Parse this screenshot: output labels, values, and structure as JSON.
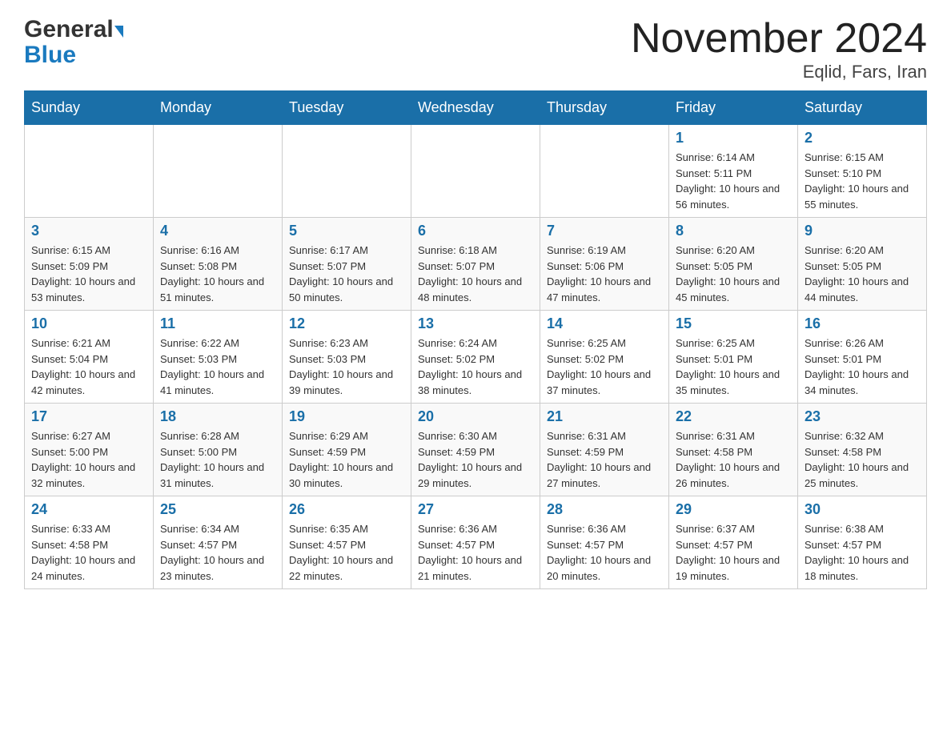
{
  "header": {
    "logo_general": "General",
    "logo_blue": "Blue",
    "month_title": "November 2024",
    "location": "Eqlid, Fars, Iran"
  },
  "weekdays": [
    "Sunday",
    "Monday",
    "Tuesday",
    "Wednesday",
    "Thursday",
    "Friday",
    "Saturday"
  ],
  "weeks": [
    [
      {
        "day": "",
        "sunrise": "",
        "sunset": "",
        "daylight": ""
      },
      {
        "day": "",
        "sunrise": "",
        "sunset": "",
        "daylight": ""
      },
      {
        "day": "",
        "sunrise": "",
        "sunset": "",
        "daylight": ""
      },
      {
        "day": "",
        "sunrise": "",
        "sunset": "",
        "daylight": ""
      },
      {
        "day": "",
        "sunrise": "",
        "sunset": "",
        "daylight": ""
      },
      {
        "day": "1",
        "sunrise": "Sunrise: 6:14 AM",
        "sunset": "Sunset: 5:11 PM",
        "daylight": "Daylight: 10 hours and 56 minutes."
      },
      {
        "day": "2",
        "sunrise": "Sunrise: 6:15 AM",
        "sunset": "Sunset: 5:10 PM",
        "daylight": "Daylight: 10 hours and 55 minutes."
      }
    ],
    [
      {
        "day": "3",
        "sunrise": "Sunrise: 6:15 AM",
        "sunset": "Sunset: 5:09 PM",
        "daylight": "Daylight: 10 hours and 53 minutes."
      },
      {
        "day": "4",
        "sunrise": "Sunrise: 6:16 AM",
        "sunset": "Sunset: 5:08 PM",
        "daylight": "Daylight: 10 hours and 51 minutes."
      },
      {
        "day": "5",
        "sunrise": "Sunrise: 6:17 AM",
        "sunset": "Sunset: 5:07 PM",
        "daylight": "Daylight: 10 hours and 50 minutes."
      },
      {
        "day": "6",
        "sunrise": "Sunrise: 6:18 AM",
        "sunset": "Sunset: 5:07 PM",
        "daylight": "Daylight: 10 hours and 48 minutes."
      },
      {
        "day": "7",
        "sunrise": "Sunrise: 6:19 AM",
        "sunset": "Sunset: 5:06 PM",
        "daylight": "Daylight: 10 hours and 47 minutes."
      },
      {
        "day": "8",
        "sunrise": "Sunrise: 6:20 AM",
        "sunset": "Sunset: 5:05 PM",
        "daylight": "Daylight: 10 hours and 45 minutes."
      },
      {
        "day": "9",
        "sunrise": "Sunrise: 6:20 AM",
        "sunset": "Sunset: 5:05 PM",
        "daylight": "Daylight: 10 hours and 44 minutes."
      }
    ],
    [
      {
        "day": "10",
        "sunrise": "Sunrise: 6:21 AM",
        "sunset": "Sunset: 5:04 PM",
        "daylight": "Daylight: 10 hours and 42 minutes."
      },
      {
        "day": "11",
        "sunrise": "Sunrise: 6:22 AM",
        "sunset": "Sunset: 5:03 PM",
        "daylight": "Daylight: 10 hours and 41 minutes."
      },
      {
        "day": "12",
        "sunrise": "Sunrise: 6:23 AM",
        "sunset": "Sunset: 5:03 PM",
        "daylight": "Daylight: 10 hours and 39 minutes."
      },
      {
        "day": "13",
        "sunrise": "Sunrise: 6:24 AM",
        "sunset": "Sunset: 5:02 PM",
        "daylight": "Daylight: 10 hours and 38 minutes."
      },
      {
        "day": "14",
        "sunrise": "Sunrise: 6:25 AM",
        "sunset": "Sunset: 5:02 PM",
        "daylight": "Daylight: 10 hours and 37 minutes."
      },
      {
        "day": "15",
        "sunrise": "Sunrise: 6:25 AM",
        "sunset": "Sunset: 5:01 PM",
        "daylight": "Daylight: 10 hours and 35 minutes."
      },
      {
        "day": "16",
        "sunrise": "Sunrise: 6:26 AM",
        "sunset": "Sunset: 5:01 PM",
        "daylight": "Daylight: 10 hours and 34 minutes."
      }
    ],
    [
      {
        "day": "17",
        "sunrise": "Sunrise: 6:27 AM",
        "sunset": "Sunset: 5:00 PM",
        "daylight": "Daylight: 10 hours and 32 minutes."
      },
      {
        "day": "18",
        "sunrise": "Sunrise: 6:28 AM",
        "sunset": "Sunset: 5:00 PM",
        "daylight": "Daylight: 10 hours and 31 minutes."
      },
      {
        "day": "19",
        "sunrise": "Sunrise: 6:29 AM",
        "sunset": "Sunset: 4:59 PM",
        "daylight": "Daylight: 10 hours and 30 minutes."
      },
      {
        "day": "20",
        "sunrise": "Sunrise: 6:30 AM",
        "sunset": "Sunset: 4:59 PM",
        "daylight": "Daylight: 10 hours and 29 minutes."
      },
      {
        "day": "21",
        "sunrise": "Sunrise: 6:31 AM",
        "sunset": "Sunset: 4:59 PM",
        "daylight": "Daylight: 10 hours and 27 minutes."
      },
      {
        "day": "22",
        "sunrise": "Sunrise: 6:31 AM",
        "sunset": "Sunset: 4:58 PM",
        "daylight": "Daylight: 10 hours and 26 minutes."
      },
      {
        "day": "23",
        "sunrise": "Sunrise: 6:32 AM",
        "sunset": "Sunset: 4:58 PM",
        "daylight": "Daylight: 10 hours and 25 minutes."
      }
    ],
    [
      {
        "day": "24",
        "sunrise": "Sunrise: 6:33 AM",
        "sunset": "Sunset: 4:58 PM",
        "daylight": "Daylight: 10 hours and 24 minutes."
      },
      {
        "day": "25",
        "sunrise": "Sunrise: 6:34 AM",
        "sunset": "Sunset: 4:57 PM",
        "daylight": "Daylight: 10 hours and 23 minutes."
      },
      {
        "day": "26",
        "sunrise": "Sunrise: 6:35 AM",
        "sunset": "Sunset: 4:57 PM",
        "daylight": "Daylight: 10 hours and 22 minutes."
      },
      {
        "day": "27",
        "sunrise": "Sunrise: 6:36 AM",
        "sunset": "Sunset: 4:57 PM",
        "daylight": "Daylight: 10 hours and 21 minutes."
      },
      {
        "day": "28",
        "sunrise": "Sunrise: 6:36 AM",
        "sunset": "Sunset: 4:57 PM",
        "daylight": "Daylight: 10 hours and 20 minutes."
      },
      {
        "day": "29",
        "sunrise": "Sunrise: 6:37 AM",
        "sunset": "Sunset: 4:57 PM",
        "daylight": "Daylight: 10 hours and 19 minutes."
      },
      {
        "day": "30",
        "sunrise": "Sunrise: 6:38 AM",
        "sunset": "Sunset: 4:57 PM",
        "daylight": "Daylight: 10 hours and 18 minutes."
      }
    ]
  ]
}
